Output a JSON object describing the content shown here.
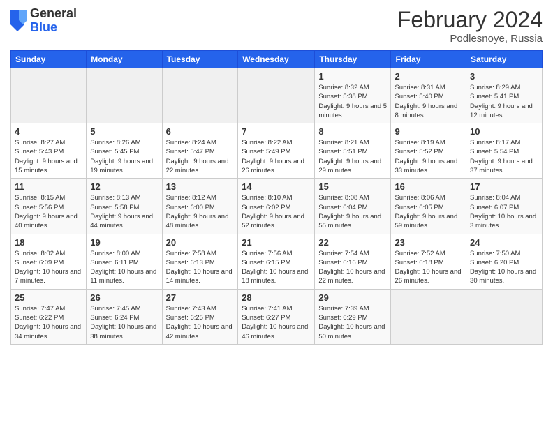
{
  "header": {
    "logo": {
      "general": "General",
      "blue": "Blue"
    },
    "title": "February 2024",
    "location": "Podlesnoye, Russia"
  },
  "days_of_week": [
    "Sunday",
    "Monday",
    "Tuesday",
    "Wednesday",
    "Thursday",
    "Friday",
    "Saturday"
  ],
  "weeks": [
    [
      {
        "day": "",
        "info": ""
      },
      {
        "day": "",
        "info": ""
      },
      {
        "day": "",
        "info": ""
      },
      {
        "day": "",
        "info": ""
      },
      {
        "day": "1",
        "info": "Sunrise: 8:32 AM\nSunset: 5:38 PM\nDaylight: 9 hours and 5 minutes."
      },
      {
        "day": "2",
        "info": "Sunrise: 8:31 AM\nSunset: 5:40 PM\nDaylight: 9 hours and 8 minutes."
      },
      {
        "day": "3",
        "info": "Sunrise: 8:29 AM\nSunset: 5:41 PM\nDaylight: 9 hours and 12 minutes."
      }
    ],
    [
      {
        "day": "4",
        "info": "Sunrise: 8:27 AM\nSunset: 5:43 PM\nDaylight: 9 hours and 15 minutes."
      },
      {
        "day": "5",
        "info": "Sunrise: 8:26 AM\nSunset: 5:45 PM\nDaylight: 9 hours and 19 minutes."
      },
      {
        "day": "6",
        "info": "Sunrise: 8:24 AM\nSunset: 5:47 PM\nDaylight: 9 hours and 22 minutes."
      },
      {
        "day": "7",
        "info": "Sunrise: 8:22 AM\nSunset: 5:49 PM\nDaylight: 9 hours and 26 minutes."
      },
      {
        "day": "8",
        "info": "Sunrise: 8:21 AM\nSunset: 5:51 PM\nDaylight: 9 hours and 29 minutes."
      },
      {
        "day": "9",
        "info": "Sunrise: 8:19 AM\nSunset: 5:52 PM\nDaylight: 9 hours and 33 minutes."
      },
      {
        "day": "10",
        "info": "Sunrise: 8:17 AM\nSunset: 5:54 PM\nDaylight: 9 hours and 37 minutes."
      }
    ],
    [
      {
        "day": "11",
        "info": "Sunrise: 8:15 AM\nSunset: 5:56 PM\nDaylight: 9 hours and 40 minutes."
      },
      {
        "day": "12",
        "info": "Sunrise: 8:13 AM\nSunset: 5:58 PM\nDaylight: 9 hours and 44 minutes."
      },
      {
        "day": "13",
        "info": "Sunrise: 8:12 AM\nSunset: 6:00 PM\nDaylight: 9 hours and 48 minutes."
      },
      {
        "day": "14",
        "info": "Sunrise: 8:10 AM\nSunset: 6:02 PM\nDaylight: 9 hours and 52 minutes."
      },
      {
        "day": "15",
        "info": "Sunrise: 8:08 AM\nSunset: 6:04 PM\nDaylight: 9 hours and 55 minutes."
      },
      {
        "day": "16",
        "info": "Sunrise: 8:06 AM\nSunset: 6:05 PM\nDaylight: 9 hours and 59 minutes."
      },
      {
        "day": "17",
        "info": "Sunrise: 8:04 AM\nSunset: 6:07 PM\nDaylight: 10 hours and 3 minutes."
      }
    ],
    [
      {
        "day": "18",
        "info": "Sunrise: 8:02 AM\nSunset: 6:09 PM\nDaylight: 10 hours and 7 minutes."
      },
      {
        "day": "19",
        "info": "Sunrise: 8:00 AM\nSunset: 6:11 PM\nDaylight: 10 hours and 11 minutes."
      },
      {
        "day": "20",
        "info": "Sunrise: 7:58 AM\nSunset: 6:13 PM\nDaylight: 10 hours and 14 minutes."
      },
      {
        "day": "21",
        "info": "Sunrise: 7:56 AM\nSunset: 6:15 PM\nDaylight: 10 hours and 18 minutes."
      },
      {
        "day": "22",
        "info": "Sunrise: 7:54 AM\nSunset: 6:16 PM\nDaylight: 10 hours and 22 minutes."
      },
      {
        "day": "23",
        "info": "Sunrise: 7:52 AM\nSunset: 6:18 PM\nDaylight: 10 hours and 26 minutes."
      },
      {
        "day": "24",
        "info": "Sunrise: 7:50 AM\nSunset: 6:20 PM\nDaylight: 10 hours and 30 minutes."
      }
    ],
    [
      {
        "day": "25",
        "info": "Sunrise: 7:47 AM\nSunset: 6:22 PM\nDaylight: 10 hours and 34 minutes."
      },
      {
        "day": "26",
        "info": "Sunrise: 7:45 AM\nSunset: 6:24 PM\nDaylight: 10 hours and 38 minutes."
      },
      {
        "day": "27",
        "info": "Sunrise: 7:43 AM\nSunset: 6:25 PM\nDaylight: 10 hours and 42 minutes."
      },
      {
        "day": "28",
        "info": "Sunrise: 7:41 AM\nSunset: 6:27 PM\nDaylight: 10 hours and 46 minutes."
      },
      {
        "day": "29",
        "info": "Sunrise: 7:39 AM\nSunset: 6:29 PM\nDaylight: 10 hours and 50 minutes."
      },
      {
        "day": "",
        "info": ""
      },
      {
        "day": "",
        "info": ""
      }
    ]
  ]
}
